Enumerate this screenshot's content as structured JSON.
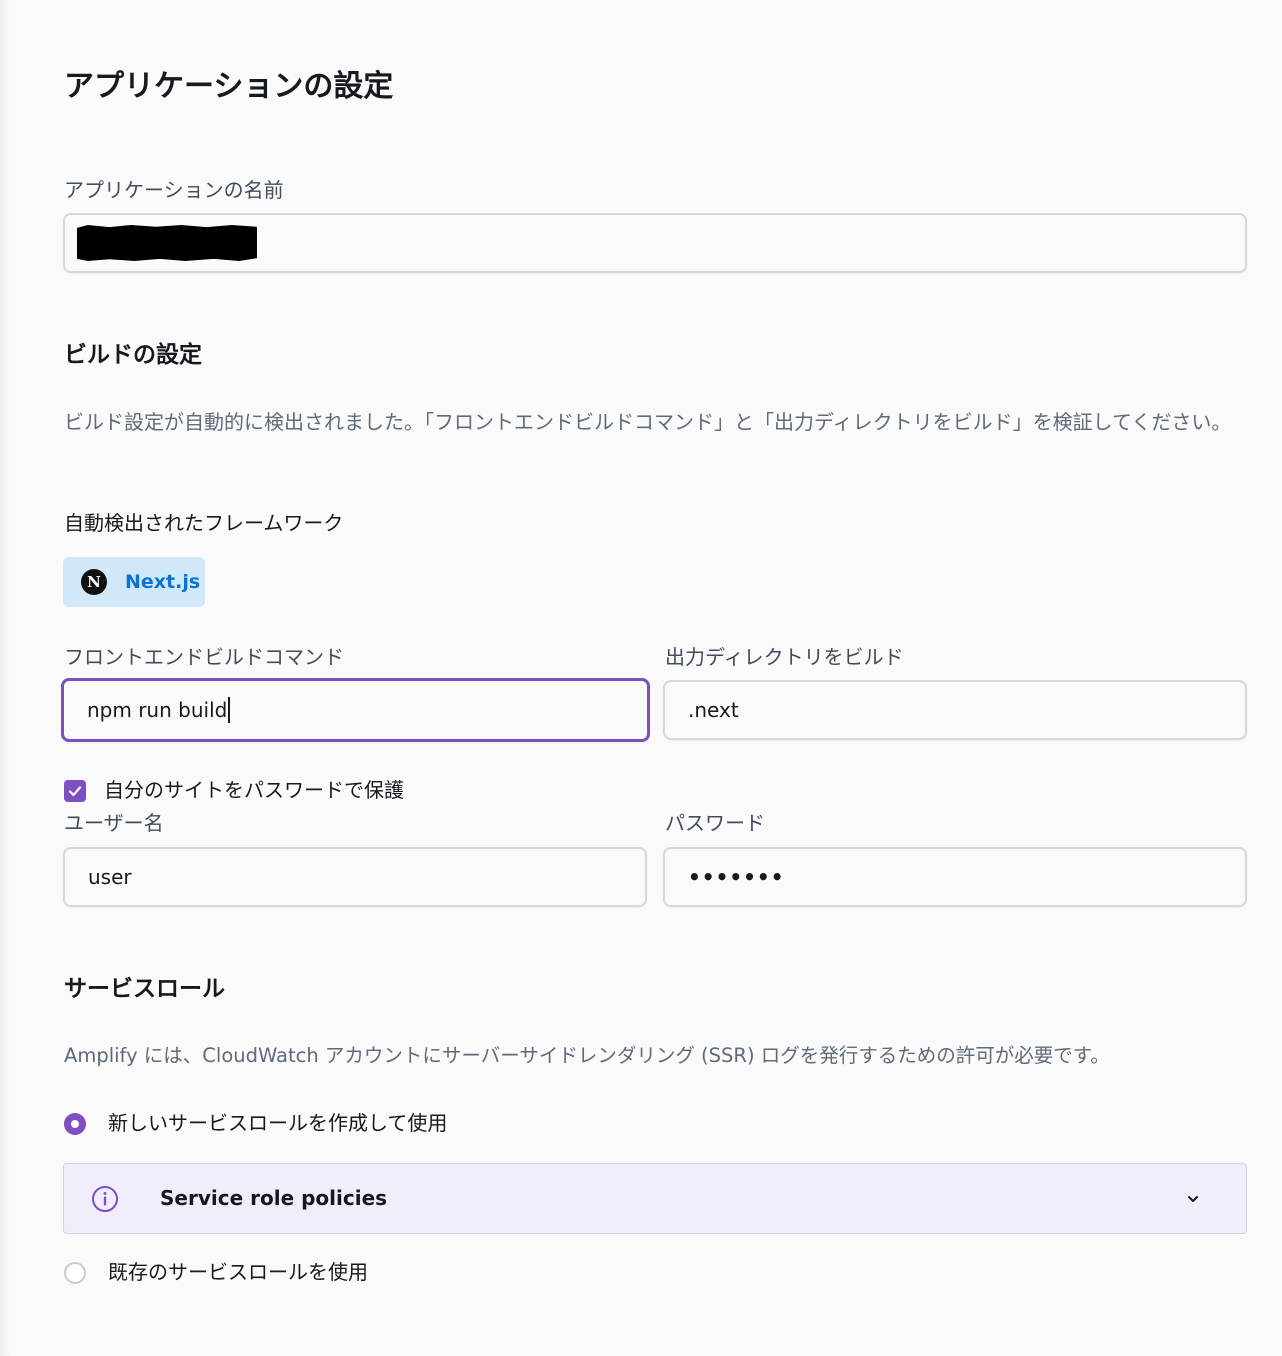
{
  "page": {
    "title": "アプリケーションの設定"
  },
  "app_name": {
    "label": "アプリケーションの名前",
    "value": ""
  },
  "build": {
    "heading": "ビルドの設定",
    "description": "ビルド設定が自動的に検出されました。「フロントエンドビルドコマンド」と「出力ディレクトリをビルド」を検証してください。",
    "framework_label": "自動検出されたフレームワーク",
    "framework_name": "Next.js",
    "framework_logo_letter": "N",
    "command_label": "フロントエンドビルドコマンド",
    "command_value": "npm run build",
    "output_label": "出力ディレクトリをビルド",
    "output_value": ".next"
  },
  "protect": {
    "checkbox_label": "自分のサイトをパスワードで保護",
    "checked": true,
    "username_label": "ユーザー名",
    "username_value": "user",
    "password_label": "パスワード",
    "password_value": "•••••••"
  },
  "service_role": {
    "heading": "サービスロール",
    "description": "Amplify には、CloudWatch アカウントにサーバーサイドレンダリング (SSR) ログを発行するための許可が必要です。",
    "option_new": "新しいサービスロールを作成して使用",
    "option_existing": "既存のサービスロールを使用",
    "selected": "new",
    "info_panel_title": "Service role policies"
  },
  "colors": {
    "accent": "#7d4fbf",
    "badge_bg": "#d1e8f9",
    "badge_text": "#0972d3",
    "info_bg": "#f1eefb"
  },
  "icons": {
    "checkbox": "check-icon",
    "info": "info-icon",
    "expand": "chevron-down-icon",
    "framework": "nextjs-logo-icon"
  }
}
